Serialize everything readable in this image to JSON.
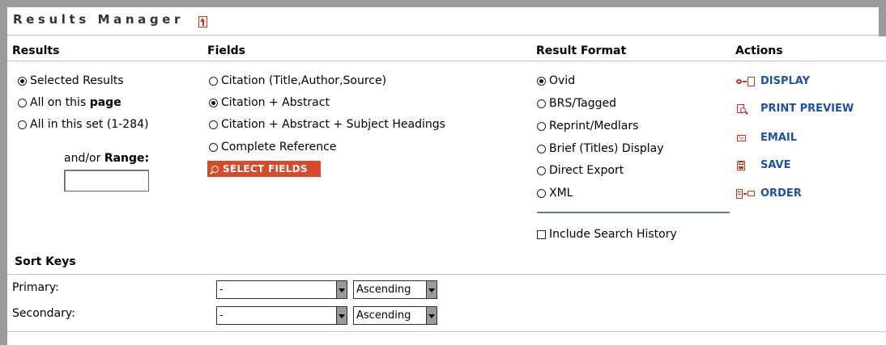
{
  "title": "Results Manager",
  "colors": {
    "accent_red": "#d64a2c",
    "action_blue": "#1c52a8",
    "frame_gray": "#9a9a9a"
  },
  "columns": {
    "results": "Results",
    "fields": "Fields",
    "result_format": "Result Format",
    "actions": "Actions"
  },
  "results": {
    "selected": "Selected Results",
    "all_page_prefix": "All on this ",
    "all_page_bold": "page",
    "all_set": "All in this set (1-284)",
    "range_prefix": "and/or ",
    "range_bold": "Range:",
    "range_value": ""
  },
  "fields": {
    "citation": "Citation (Title,Author,Source)",
    "citation_abstract": "Citation + Abstract",
    "citation_abstract_subject": "Citation + Abstract + Subject Headings",
    "complete": "Complete Reference",
    "select_button": "SELECT FIELDS"
  },
  "formats": {
    "ovid": "Ovid",
    "brs": "BRS/Tagged",
    "reprint": "Reprint/Medlars",
    "brief": "Brief (Titles) Display",
    "direct": "Direct Export",
    "xml": "XML",
    "include_history": "Include Search History"
  },
  "actions": {
    "display": "DISPLAY",
    "print_preview": "PRINT PREVIEW",
    "email": "EMAIL",
    "save": "SAVE",
    "order": "ORDER"
  },
  "sort": {
    "heading": "Sort Keys",
    "primary_label": "Primary:",
    "secondary_label": "Secondary:",
    "primary_field": "-",
    "primary_order": "Ascending",
    "secondary_field": "-",
    "secondary_order": "Ascending"
  }
}
